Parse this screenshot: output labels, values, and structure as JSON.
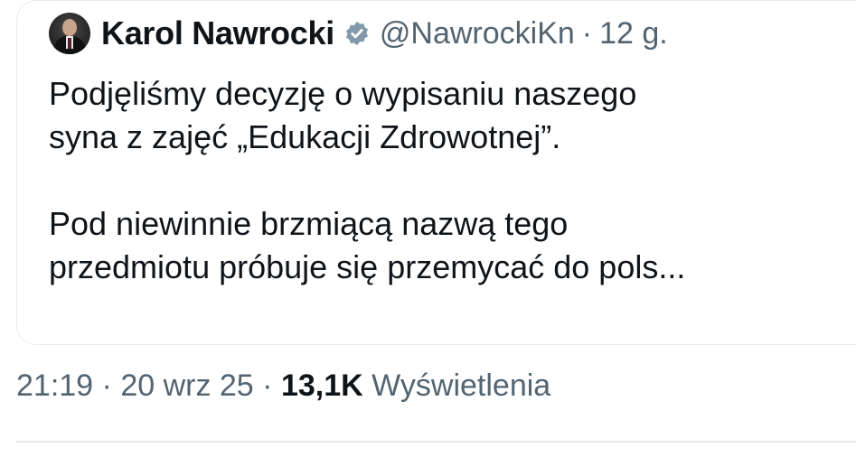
{
  "quote": {
    "author": {
      "name": "Karol Nawrocki",
      "handle": "@NawrockiKn",
      "separator": "·",
      "age": "12 g."
    },
    "paragraphs": [
      "Podjęliśmy decyzję o wypisaniu naszego\nsyna z zajęć „Edukacji Zdrowotnej”.",
      "Pod niewinnie brzmiącą nazwą tego\nprzedmiotu próbuje się przemycać do pols..."
    ]
  },
  "meta": {
    "time": "21:19",
    "sep1": " · ",
    "date": "20 wrz 25",
    "sep2": " · ",
    "views_count": "13,1K",
    "views_label": " Wyświetlenia"
  },
  "colors": {
    "text": "#0f1419",
    "secondary": "#536471",
    "verified_badge": "#829aab",
    "border": "#e6ecf0"
  },
  "icons": {
    "verified": "verified-badge-icon"
  }
}
